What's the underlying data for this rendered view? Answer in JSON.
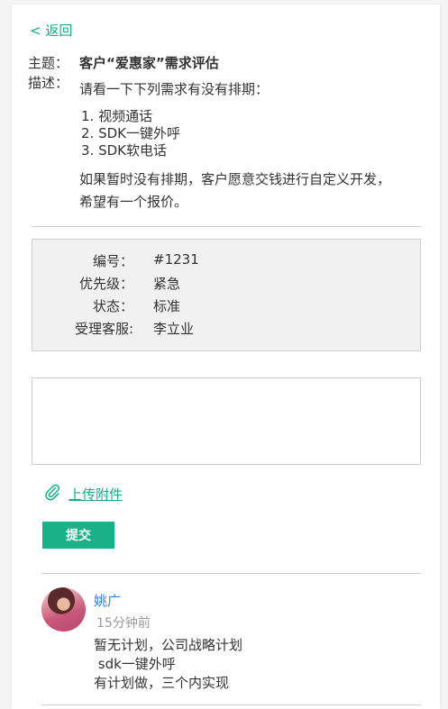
{
  "back_label": "< 返回",
  "ticket": {
    "subject_label": "主题：",
    "subject": "客户“爱惠家”需求评估",
    "desc_label": "描述：",
    "desc_intro": "请看一下下列需求有没有排期：",
    "desc_items": [
      "1. 视频通话",
      "2. SDK一键外呼",
      "3. SDK软电话"
    ],
    "desc_para_line1": "如果暂时没有排期，客户愿意交钱进行自定义开发，",
    "desc_para_line2": "希望有一个报价。"
  },
  "info": {
    "number_label": "编号：",
    "number": "#1231",
    "priority_label": "优先级：",
    "priority": "紧急",
    "status_label": "状态：",
    "status": "标准",
    "agent_label": "受理客服:",
    "agent": "李立业"
  },
  "reply": {
    "placeholder": "",
    "value": ""
  },
  "upload_label": "上传附件",
  "submit_label": "提交",
  "comment": {
    "author": "姚广",
    "time": "15分钟前",
    "lines": [
      "暂无计划，公司战略计划",
      " sdk一键外呼",
      "有计划做，三个内实现"
    ]
  },
  "colors": {
    "accent": "#1ab188",
    "link_blue": "#3a7bd5"
  },
  "icons": {
    "upload": "paperclip-icon"
  }
}
